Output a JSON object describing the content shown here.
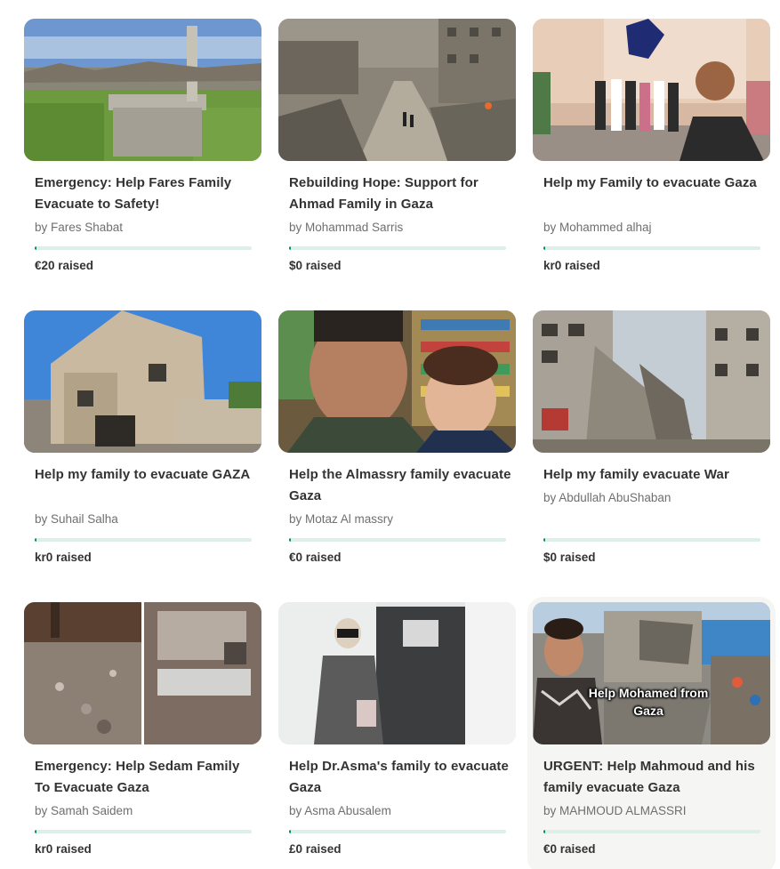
{
  "progress_color": "#018d61",
  "progress_track_color": "#dcefe9",
  "cards": [
    {
      "title": "Emergency: Help Fares Family Evacuate to Safety!",
      "organizer": "by Fares Shabat",
      "raised": "€20 raised",
      "progress": 0.01
    },
    {
      "title": "Rebuilding Hope: Support for Ahmad Family in Gaza",
      "organizer": "by Mohammad Sarris",
      "raised": "$0 raised",
      "progress": 0
    },
    {
      "title": "Help my Family to evacuate Gaza",
      "organizer": "by Mohammed alhaj",
      "raised": "kr0 raised",
      "progress": 0
    },
    {
      "title": "Help my family to evacuate GAZA",
      "organizer": "by Suhail Salha",
      "raised": "kr0 raised",
      "progress": 0
    },
    {
      "title": "Help the Almassry family evacuate Gaza",
      "organizer": "by Motaz Al massry",
      "raised": "€0 raised",
      "progress": 0
    },
    {
      "title": "Help my family evacuate War",
      "organizer": "by Abdullah AbuShaban",
      "raised": "$0 raised",
      "progress": 0
    },
    {
      "title": "Emergency: Help Sedam Family To Evacuate Gaza",
      "organizer": "by Samah Saidem",
      "raised": "kr0 raised",
      "progress": 0
    },
    {
      "title": "Help Dr.Asma's family to evacuate Gaza",
      "organizer": "by Asma Abusalem",
      "raised": "£0 raised",
      "progress": 0
    },
    {
      "title": "URGENT: Help Mahmoud and his family evacuate Gaza",
      "organizer": "by MAHMOUD ALMASSRI",
      "raised": "€0 raised",
      "progress": 0,
      "image_overlay": "Help Mohamed from Gaza"
    }
  ]
}
